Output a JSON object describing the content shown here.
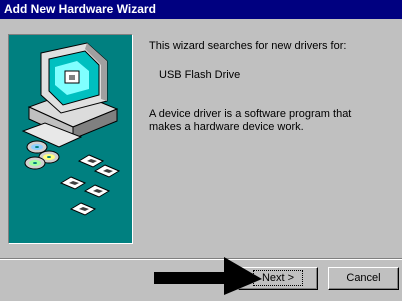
{
  "window": {
    "title": "Add New Hardware Wizard"
  },
  "content": {
    "intro": "This wizard searches for new drivers for:",
    "device_name": "USB Flash Drive",
    "description": "A device driver is a software program that makes a hardware device work."
  },
  "buttons": {
    "next": "Next >",
    "cancel": "Cancel"
  },
  "colors": {
    "titlebar": "#000080",
    "art_background": "#008080",
    "face": "#c0c0c0"
  },
  "icons": [
    "computer-icon",
    "cd-disc-icon",
    "floppy-disk-icon",
    "black-arrow-icon"
  ]
}
